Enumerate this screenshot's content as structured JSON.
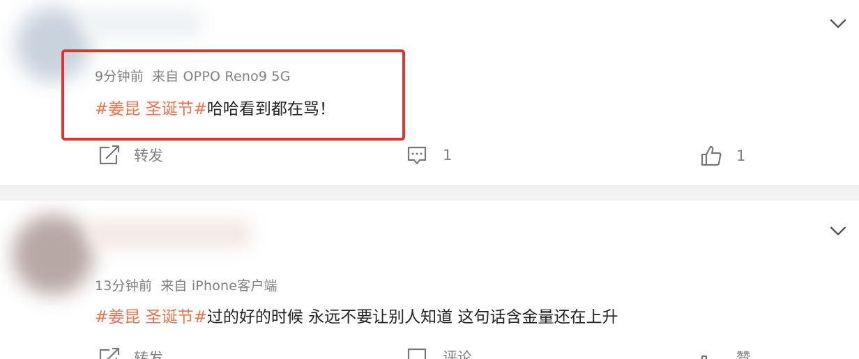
{
  "posts": [
    {
      "time": "9分钟前",
      "source": "来自 OPPO Reno9 5G",
      "hashtag": "#姜昆 圣诞节#",
      "text": "哈哈看到都在骂！",
      "repost_label": "转发",
      "comment_count": "1",
      "like_count": "1",
      "highlighted": true,
      "highlight_color": "#e0322f"
    },
    {
      "time": "13分钟前",
      "source": "来自 iPhone客户端",
      "hashtag": "#姜昆 圣诞节#",
      "text": "过的好的时候 永远不要让别人知道 这句话含金量还在上升",
      "repost_label": "转发",
      "comment_label": "评论",
      "like_label": "赞"
    }
  ],
  "icons": {
    "expand": "chevron-down-icon",
    "repost": "repost-icon",
    "comment": "comment-icon",
    "like": "thumbs-up-icon"
  },
  "colors": {
    "hashtag": "#eb7350",
    "meta_text": "#808080",
    "separator": "#f2f2f2"
  }
}
